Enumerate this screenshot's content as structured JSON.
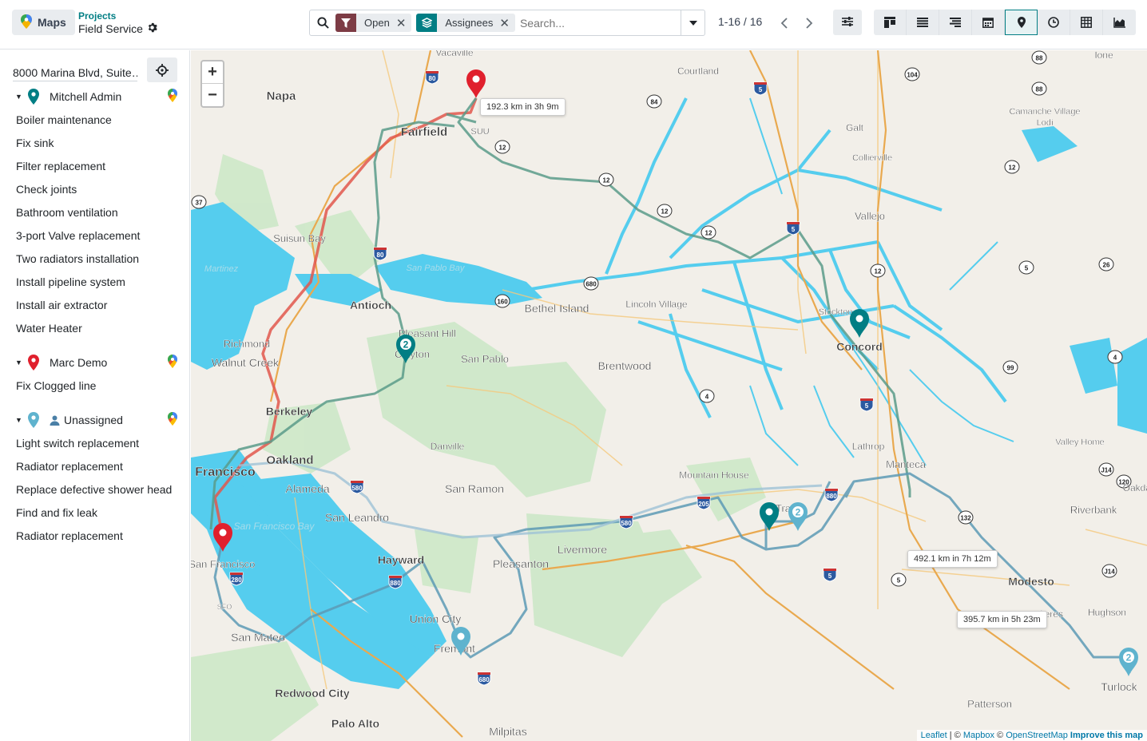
{
  "app": {
    "name": "Maps",
    "breadcrumb_parent": "Projects",
    "breadcrumb_current": "Field Service"
  },
  "search": {
    "facets": [
      {
        "label": "Open",
        "icon": "filter-icon",
        "color": "#7d3c45"
      },
      {
        "label": "Assignees",
        "icon": "layers-icon",
        "color": "#017e84"
      }
    ],
    "placeholder": "Search..."
  },
  "pager": {
    "range": "1-16 / 16"
  },
  "views": [
    "kanban",
    "list",
    "gantt",
    "calendar",
    "map",
    "activity",
    "pivot",
    "graph"
  ],
  "active_view": "map",
  "sidebar": {
    "address": "8000 Marina Blvd, Suite…",
    "groups": [
      {
        "name": "Mitchell Admin",
        "pin_color": "#017e84",
        "tasks": [
          "Boiler maintenance",
          "Fix sink",
          "Filter replacement",
          "Check joints",
          "Bathroom ventilation",
          "3-port Valve replacement",
          "Two radiators installation",
          "Install pipeline system",
          "Install air extractor",
          "Water Heater"
        ]
      },
      {
        "name": "Marc Demo",
        "pin_color": "#e0202d",
        "tasks": [
          "Fix Clogged line"
        ]
      },
      {
        "name": "Unassigned",
        "pin_color": "#5fb3ce",
        "tasks": [
          "Light switch replacement",
          "Radiator replacement",
          "Replace defective shower head",
          "Find and fix leak",
          "Radiator replacement"
        ]
      }
    ]
  },
  "map": {
    "zoom_in": "+",
    "zoom_out": "−",
    "route_labels": [
      "192.3 km in 3h 9m",
      "492.1 km in 7h 12m",
      "395.7 km in 5h 23m"
    ],
    "places": [
      "Vacaville",
      "Courtland",
      "Ione",
      "Napa",
      "Fairfield",
      "SUU",
      "Galt",
      "Collierville",
      "Camanche Village",
      "Lodi",
      "Vallejo",
      "Suisun Bay",
      "San Pablo Bay",
      "Martinez",
      "Antioch",
      "Bethel Island",
      "Lincoln Village",
      "Stockton",
      "Concord",
      "Pleasant Hill",
      "Clayton",
      "San Pablo",
      "Richmond",
      "Walnut Creek",
      "Brentwood",
      "Berkeley",
      "Danville",
      "Lathrop",
      "Manteca",
      "Valley Home",
      "Oakland",
      "Francisco",
      "Alameda",
      "San Ramon",
      "Mountain House",
      "Oakdale",
      "Riverbank",
      "San Leandro",
      "San Francisco Bay",
      "Livermore",
      "Tracy",
      "Hayward",
      "Pleasanton",
      "Modesto",
      "South San Francisco",
      "SFO",
      "Union City",
      "Ceres",
      "Hughson",
      "San Mateo",
      "Fremont",
      "Turlock",
      "Redwood City",
      "Patterson",
      "Palo Alto",
      "Milpitas"
    ],
    "highway_shields": [
      "80",
      "84",
      "5",
      "104",
      "88",
      "12",
      "37",
      "680",
      "99",
      "26",
      "J14",
      "160",
      "4",
      "580",
      "205",
      "120",
      "132",
      "280",
      "880",
      "680",
      "5",
      "5"
    ],
    "marker_counts": [
      "2",
      "2",
      "2"
    ],
    "attribution": {
      "leaflet": "Leaflet",
      "mapbox": "Mapbox",
      "osm": "OpenStreetMap",
      "improve": "Improve this map"
    }
  },
  "colors": {
    "accent": "#017e84",
    "route_red": "#e2574c",
    "route_blue": "#5d9ab5",
    "route_green": "#5a9b8a",
    "water": "#55cdee"
  }
}
